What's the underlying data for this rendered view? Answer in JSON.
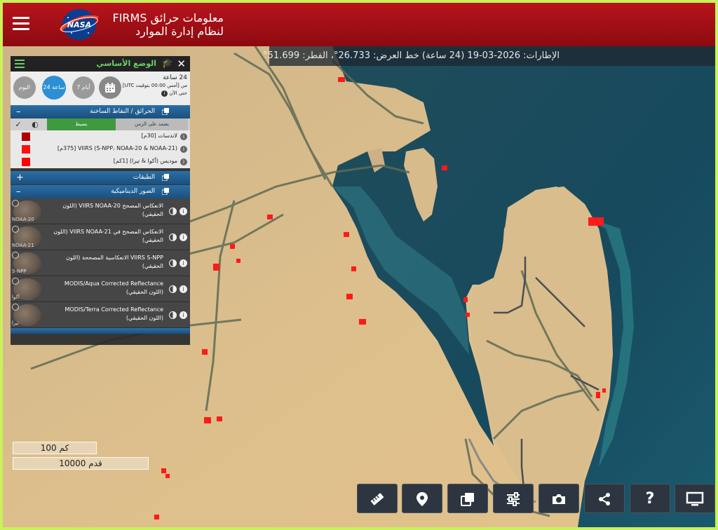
{
  "header": {
    "title_line1": "معلومات حرائق FIRMS",
    "title_line2": "لنظام إدارة الموارد",
    "logo_text": "NASA"
  },
  "infobar": {
    "text": "الإطارات: 2026-03-19 (24 ساعة)   خط العرض: 26.733°، الفطر: 51.699°"
  },
  "panel": {
    "title": "الوضع الأساسي",
    "time": {
      "range": "24 ساعة",
      "line2": "من [أمس 00:00 بتوقيت UTC]",
      "line3": "حتى الآن",
      "btn_today": "اليوم",
      "btn_24h": "24 ساعة",
      "btn_7d": "7 أيام"
    },
    "fires_section": "الحرائق / النقاط الساخنة",
    "filter_timeline": "يعتمد على الزمن",
    "filter_simple": "بسيط",
    "fire_layers": [
      {
        "label": "لاندسات [30م]",
        "color": "#b00000"
      },
      {
        "label": "VIIRS (S-NPP، NOAA-20 & NOAA-21) [375م]",
        "color": "#ff1010"
      },
      {
        "label": "مودیس (أكوا & تيرا) [1كم]",
        "color": "#ff0000"
      }
    ],
    "layers_section": "الطبقات",
    "imagery_section": "الصور الديناميكية",
    "imagery": [
      {
        "name": "الانعكاس المصحح VIIRS NOAA-20 (اللون الحقيقي)",
        "thumb": "NOAA-20"
      },
      {
        "name": "الانعكاس المصحح في VIIRS NOAA-21 (اللون الحقيقي)",
        "thumb": "NOAA-21"
      },
      {
        "name": "VIIRS S-NPP الانعكاسية المصححة (اللون الحقيقي)",
        "thumb": "S-NPP"
      },
      {
        "name": "MODIS/Aqua Corrected Reflectance (اللون الحقيقي)",
        "thumb": "أكوا"
      },
      {
        "name": "MODIS/Terra Corrected Reflectance (اللون الحقيقي)",
        "thumb": "تيرا"
      }
    ]
  },
  "scale": {
    "small": "100 كم",
    "large": "10000 قدم"
  },
  "toolbar": {
    "help_label": "?"
  },
  "colors": {
    "header": "#a50f16",
    "accent": "#6ad06a",
    "fire": "#ff1a1a"
  }
}
